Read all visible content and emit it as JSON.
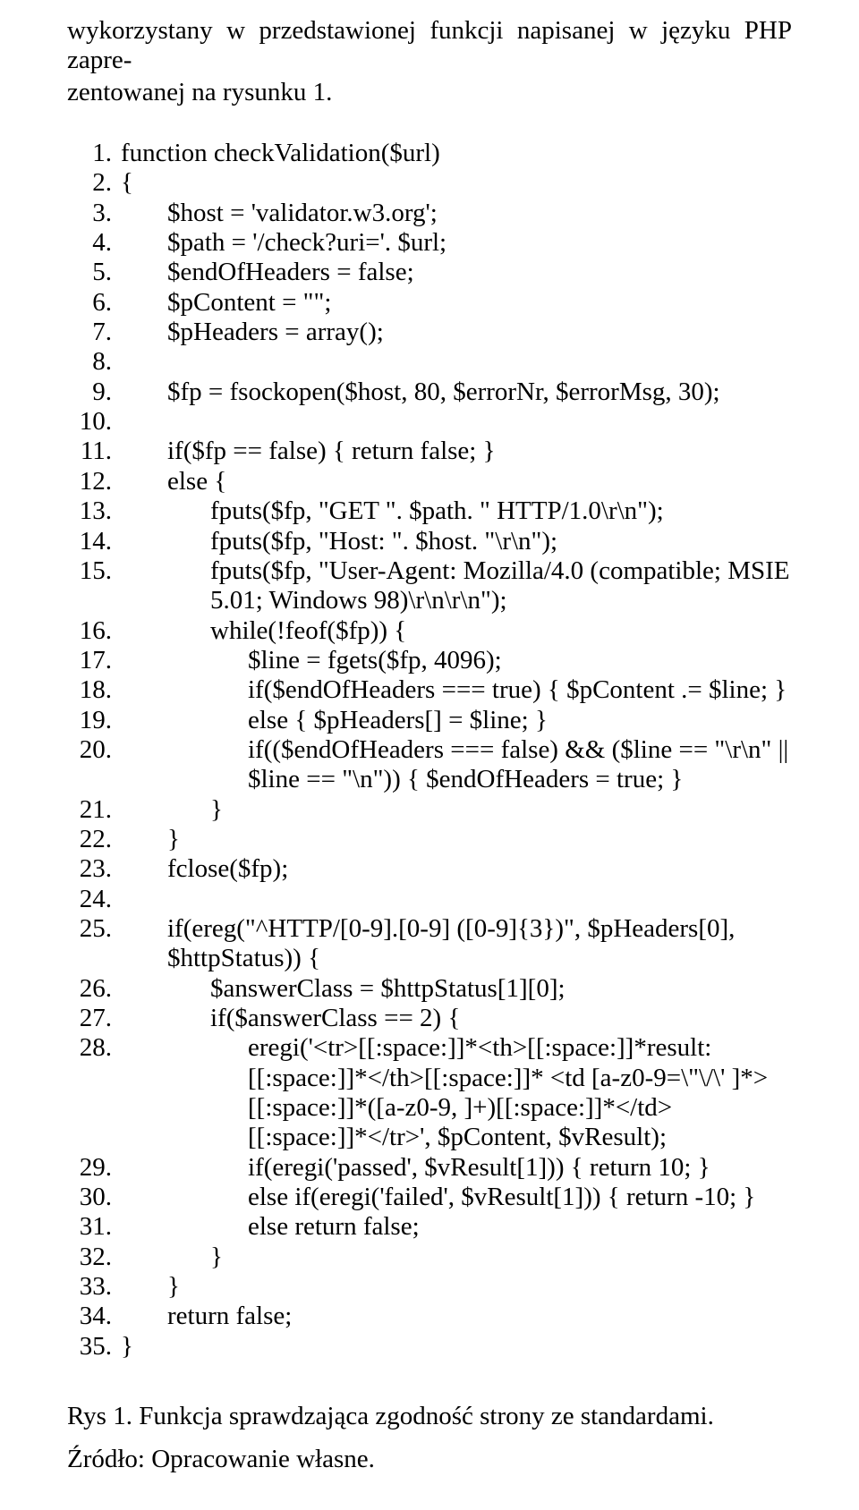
{
  "intro_line1": "wykorzystany w przedstawionej funkcji napisanej w języku PHP zapre-",
  "intro_line2": "zentowanej na rysunku 1.",
  "code": [
    {
      "n": "1.",
      "cls": "",
      "t": "function checkValidation($url)"
    },
    {
      "n": "2.",
      "cls": "",
      "t": "{"
    },
    {
      "n": "3.",
      "cls": "indent1",
      "t": "$host = 'validator.w3.org';"
    },
    {
      "n": "4.",
      "cls": "indent1",
      "t": "$path = '/check?uri='. $url;"
    },
    {
      "n": "5.",
      "cls": "indent1",
      "t": "$endOfHeaders = false;"
    },
    {
      "n": "6.",
      "cls": "indent1",
      "t": "$pContent = \"\";"
    },
    {
      "n": "7.",
      "cls": "indent1",
      "t": "$pHeaders = array();"
    },
    {
      "n": "8.",
      "cls": "",
      "t": ""
    },
    {
      "n": "9.",
      "cls": "indent1",
      "t": "$fp = fsockopen($host, 80, $errorNr, $errorMsg, 30);"
    },
    {
      "n": "10.",
      "cls": "",
      "t": ""
    },
    {
      "n": "11.",
      "cls": "indent1",
      "t": "if($fp == false) { return false; }"
    },
    {
      "n": "12.",
      "cls": "indent1",
      "t": "else {"
    },
    {
      "n": "13.",
      "cls": "indent2",
      "t": "fputs($fp, \"GET \". $path. \" HTTP/1.0\\r\\n\");"
    },
    {
      "n": "14.",
      "cls": "indent2",
      "t": "fputs($fp, \"Host: \". $host. \"\\r\\n\");"
    },
    {
      "n": "15.",
      "cls": "indent2",
      "t": "fputs($fp, \"User-Agent: Mozilla/4.0 (compatible; MSIE 5.01; Windows 98)\\r\\n\\r\\n\");"
    },
    {
      "n": "16.",
      "cls": "indent2",
      "t": "while(!feof($fp)) {"
    },
    {
      "n": "17.",
      "cls": "indent3",
      "t": "$line = fgets($fp, 4096);"
    },
    {
      "n": "18.",
      "cls": "indent3",
      "t": "if($endOfHeaders === true) { $pContent .= $line; }"
    },
    {
      "n": "19.",
      "cls": "indent3",
      "t": "else { $pHeaders[] = $line; }"
    },
    {
      "n": "20.",
      "cls": "indent3",
      "t": "if(($endOfHeaders === false) && ($line == \"\\r\\n\" || $line == \"\\n\")) { $endOfHeaders = true; }"
    },
    {
      "n": "21.",
      "cls": "indent2",
      "t": "}"
    },
    {
      "n": "22.",
      "cls": "indent1",
      "t": "}"
    },
    {
      "n": "23.",
      "cls": "indent1",
      "t": "fclose($fp);"
    },
    {
      "n": "24.",
      "cls": "",
      "t": ""
    },
    {
      "n": "25.",
      "cls": "indent1",
      "t": "if(ereg(\"^HTTP/[0-9].[0-9] ([0-9]{3})\", $pHeaders[0], $httpStatus)) {"
    },
    {
      "n": "26.",
      "cls": "indent2",
      "t": "$answerClass = $httpStatus[1][0];"
    },
    {
      "n": "27.",
      "cls": "indent2",
      "t": "if($answerClass == 2) {"
    },
    {
      "n": "28.",
      "cls": "indent3",
      "t": "eregi('<tr>[[:space:]]*<th>[[:space:]]*result:[[:space:]]*</th>[[:space:]]* <td [a-z0-9=\\\"\\/\\' ]*>[[:space:]]*([a-z0-9, ]+)[[:space:]]*</td> [[:space:]]*</tr>', $pContent, $vResult);"
    },
    {
      "n": "29.",
      "cls": "indent3",
      "t": "if(eregi('passed', $vResult[1])) { return 10; }"
    },
    {
      "n": "30.",
      "cls": "indent3",
      "t": "else if(eregi('failed', $vResult[1])) { return -10; }"
    },
    {
      "n": "31.",
      "cls": "indent3",
      "t": "else return false;"
    },
    {
      "n": "32.",
      "cls": "indent2",
      "t": "}"
    },
    {
      "n": "33.",
      "cls": "indent1",
      "t": "}"
    },
    {
      "n": "34.",
      "cls": "indent1",
      "t": "return false;"
    },
    {
      "n": "35.",
      "cls": "",
      "t": "}"
    }
  ],
  "caption": "Rys 1. Funkcja sprawdzająca zgodność strony ze standardami.",
  "source": "Źródło: Opracowanie własne."
}
